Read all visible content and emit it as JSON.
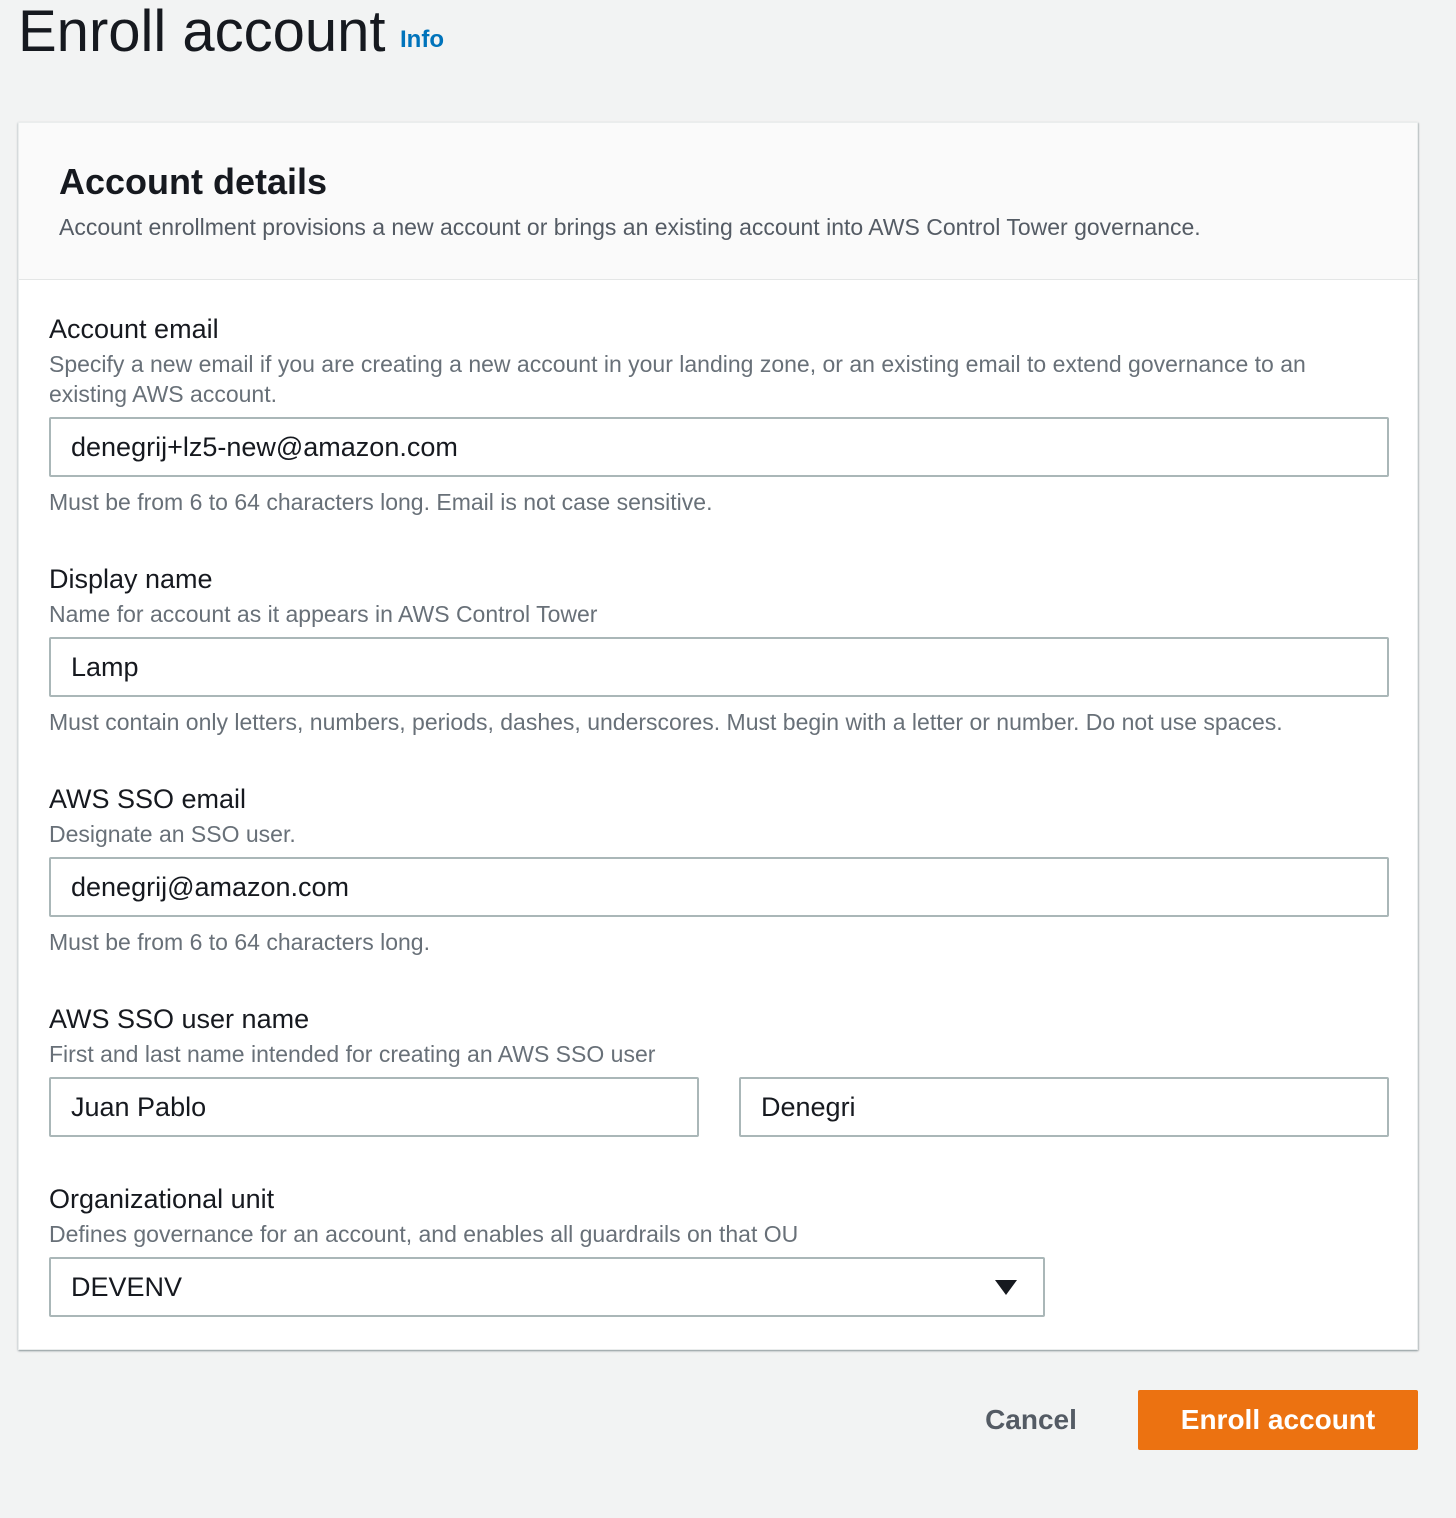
{
  "header": {
    "title": "Enroll account",
    "info_link": "Info"
  },
  "panel": {
    "title": "Account details",
    "description": "Account enrollment provisions a new account or brings an existing account into AWS Control Tower governance."
  },
  "fields": {
    "account_email": {
      "label": "Account email",
      "description_line1": "Specify a new email if you are creating a new account in your landing zone, or an existing email to extend governance to an",
      "description_line2": "existing AWS account.",
      "value": "denegrij+lz5-new@amazon.com",
      "hint": "Must be from 6 to 64 characters long. Email is not case sensitive."
    },
    "display_name": {
      "label": "Display name",
      "description": "Name for account as it appears in AWS Control Tower",
      "value": "Lamp",
      "hint": "Must contain only letters, numbers, periods, dashes, underscores. Must begin with a letter or number. Do not use spaces."
    },
    "sso_email": {
      "label": "AWS SSO email",
      "description": "Designate an SSO user.",
      "value": "denegrij@amazon.com",
      "hint": "Must be from 6 to 64 characters long."
    },
    "sso_user_name": {
      "label": "AWS SSO user name",
      "description": "First and last name intended for creating an AWS SSO user",
      "first_name": "Juan Pablo",
      "last_name": "Denegri"
    },
    "organizational_unit": {
      "label": "Organizational unit",
      "description": "Defines governance for an account, and enables all guardrails on that OU",
      "selected": "DEVENV",
      "icon": "caret-down-icon"
    }
  },
  "actions": {
    "cancel": "Cancel",
    "submit": "Enroll account"
  },
  "colors": {
    "primary_button": "#ec7211",
    "link": "#0073bb",
    "background": "#f2f3f3"
  }
}
